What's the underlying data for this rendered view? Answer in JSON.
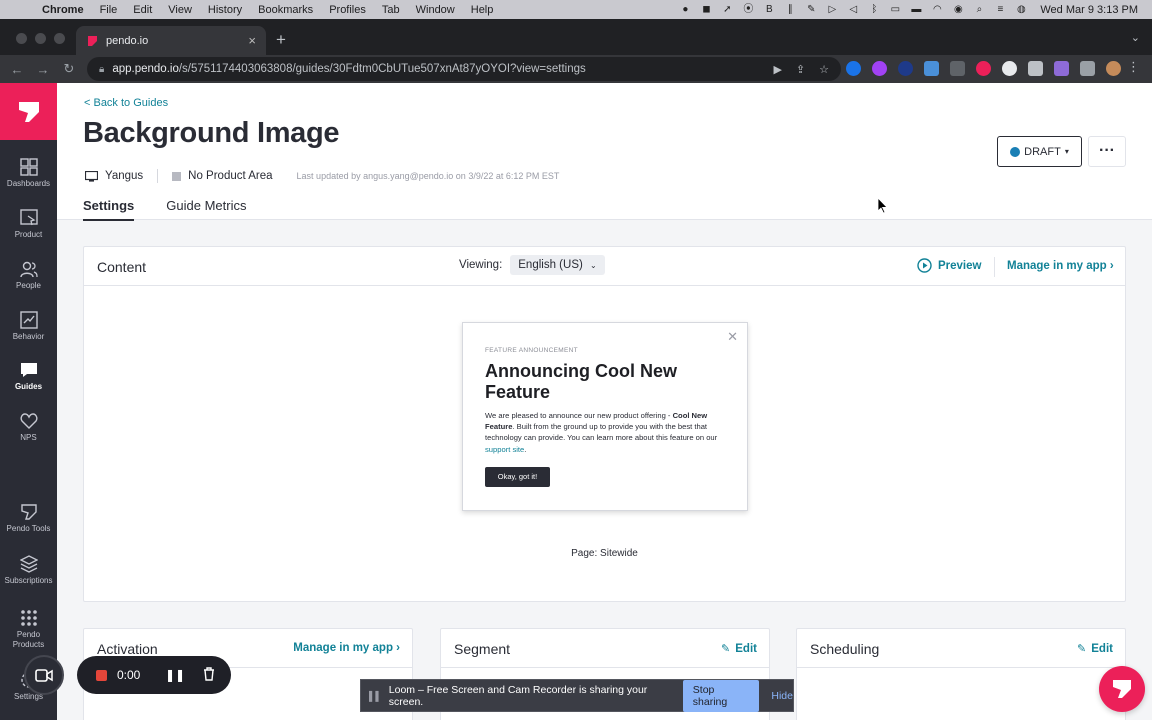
{
  "menubar": {
    "app": "Chrome",
    "items": [
      "File",
      "Edit",
      "View",
      "History",
      "Bookmarks",
      "Profiles",
      "Tab",
      "Window",
      "Help"
    ],
    "clock": "Wed Mar 9  3:13 PM"
  },
  "browser": {
    "tab_title": "pendo.io",
    "url_host": "app.pendo.io",
    "url_path": "/s/5751174403063808/guides/30Fdtm0CbUTue507xnAt87yOYOI?view=settings"
  },
  "sidebar": {
    "items": [
      {
        "label": "Dashboards",
        "icon": "dashboards-icon"
      },
      {
        "label": "Product",
        "icon": "product-icon"
      },
      {
        "label": "People",
        "icon": "people-icon"
      },
      {
        "label": "Behavior",
        "icon": "behavior-icon"
      },
      {
        "label": "Guides",
        "icon": "guides-icon"
      },
      {
        "label": "NPS",
        "icon": "nps-icon"
      },
      {
        "label": "Pendo Tools",
        "icon": "pendo-tools-icon"
      },
      {
        "label": "Subscriptions",
        "icon": "subscriptions-icon"
      },
      {
        "label": "Pendo Products",
        "icon": "pendo-products-icon"
      },
      {
        "label": "Settings",
        "icon": "settings-icon"
      }
    ],
    "active": "Guides"
  },
  "header": {
    "back_link": "< Back to Guides",
    "title": "Background Image",
    "app_name": "Yangus",
    "product_area": "No Product Area",
    "last_updated": "Last updated by angus.yang@pendo.io on 3/9/22 at 6:12 PM EST",
    "status": "DRAFT",
    "tabs": [
      "Settings",
      "Guide Metrics"
    ],
    "active_tab": "Settings"
  },
  "content_card": {
    "title": "Content",
    "viewing_label": "Viewing:",
    "language": "English (US)",
    "preview_label": "Preview",
    "manage_label": "Manage in my app ›",
    "page_label": "Page: Sitewide"
  },
  "guide": {
    "kicker": "FEATURE ANNOUNCEMENT",
    "title": "Announcing Cool New Feature",
    "body_1": "We are pleased to announce our new product offering - ",
    "body_bold": "Cool New Feature",
    "body_2": ". Built from the ground up to provide you with the best that technology can provide. You can learn more about this feature on our ",
    "body_link": "support site",
    "body_3": ".",
    "button": "Okay, got it!"
  },
  "cards": {
    "activation": {
      "title": "Activation",
      "link": "Manage in my app ›"
    },
    "segment": {
      "title": "Segment",
      "link": "Edit"
    },
    "scheduling": {
      "title": "Scheduling",
      "link": "Edit"
    }
  },
  "recorder": {
    "time": "0:00"
  },
  "loom": {
    "message": "Loom – Free Screen and Cam Recorder is sharing your screen.",
    "stop": "Stop sharing",
    "hide": "Hide"
  },
  "colors": {
    "pendo_pink": "#ec2059",
    "teal_link": "#128297",
    "sidebar_bg": "#2a2c35",
    "draft_dot": "#1a7fb5"
  }
}
